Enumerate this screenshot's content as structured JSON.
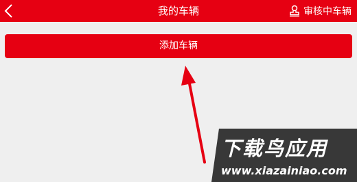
{
  "header": {
    "title": "我的车辆",
    "back_icon": "chevron-left-icon",
    "review_label": "审核中车辆",
    "review_icon": "stamp-icon",
    "background_color": "#e60012"
  },
  "main": {
    "add_vehicle_label": "添加车辆",
    "button_color": "#e60012",
    "background_color": "#efefef"
  },
  "annotation": {
    "arrow_color": "#e60012"
  },
  "watermark": {
    "title": "下载鸟应用",
    "url": "www.xiazainiao.com"
  }
}
